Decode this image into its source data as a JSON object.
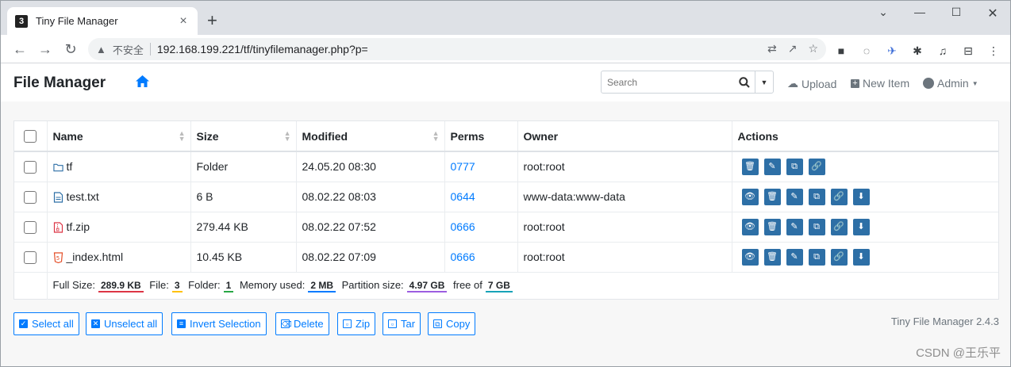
{
  "browser": {
    "tab_title": "Tiny File Manager",
    "favicon_char": "3",
    "insecure_label": "不安全",
    "url": "192.168.199.221/tf/tinyfilemanager.php?p="
  },
  "app": {
    "brand": "File Manager",
    "search_placeholder": "Search",
    "upload": "Upload",
    "new_item": "New Item",
    "admin": "Admin",
    "accent_color": "#007bff",
    "action_color": "#2d6fa6"
  },
  "table": {
    "headers": {
      "name": "Name",
      "size": "Size",
      "modified": "Modified",
      "perms": "Perms",
      "owner": "Owner",
      "actions": "Actions"
    },
    "rows": [
      {
        "icon": "folder-icon",
        "name": "tf",
        "size": "Folder",
        "modified": "24.05.20 08:30",
        "perms": "0777",
        "owner": "root:root"
      },
      {
        "icon": "text-file-icon",
        "name": "test.txt",
        "size": "6 B",
        "modified": "08.02.22 08:03",
        "perms": "0644",
        "owner": "www-data:www-data"
      },
      {
        "icon": "zip-file-icon",
        "name": "tf.zip",
        "size": "279.44 KB",
        "modified": "08.02.22 07:52",
        "perms": "0666",
        "owner": "root:root"
      },
      {
        "icon": "html5-icon",
        "name": "_index.html",
        "size": "10.45 KB",
        "modified": "08.02.22 07:09",
        "perms": "0666",
        "owner": "root:root"
      }
    ]
  },
  "summary": {
    "full_size_label": "Full Size:",
    "full_size": "289.9 KB",
    "file_label": "File:",
    "file_count": "3",
    "folder_label": "Folder:",
    "folder_count": "1",
    "memory_label": "Memory used:",
    "memory": "2 MB",
    "partition_label": "Partition size:",
    "partition": "4.97 GB",
    "free_label": "free of",
    "total": "7 GB",
    "colors": [
      "#dc3545",
      "#ffc107",
      "#28a745",
      "#007bff",
      "#9c5de0",
      "#17a2b8"
    ]
  },
  "bottom_buttons": {
    "select_all": "Select all",
    "unselect_all": "Unselect all",
    "invert": "Invert Selection",
    "delete": "Delete",
    "zip": "Zip",
    "tar": "Tar",
    "copy": "Copy"
  },
  "version": "Tiny File Manager 2.4.3",
  "watermark": "CSDN @王乐平"
}
